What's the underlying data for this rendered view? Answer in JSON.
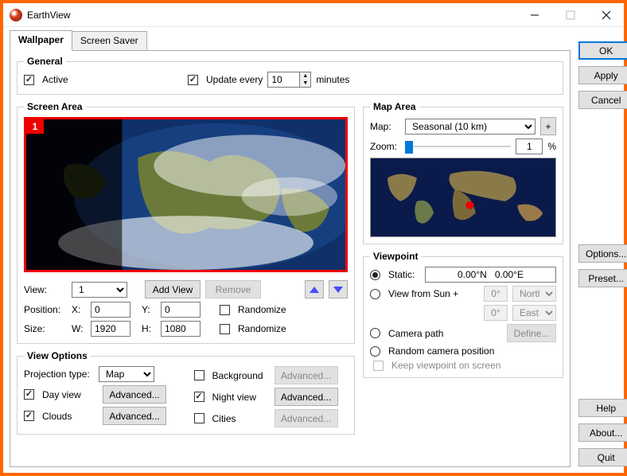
{
  "window": {
    "title": "EarthView"
  },
  "sidebar": {
    "ok": "OK",
    "apply": "Apply",
    "cancel": "Cancel",
    "options": "Options...",
    "preset": "Preset...",
    "help": "Help",
    "about": "About...",
    "quit": "Quit"
  },
  "tabs": {
    "wallpaper": "Wallpaper",
    "screensaver": "Screen Saver"
  },
  "general": {
    "legend": "General",
    "active": "Active",
    "update_every": "Update every",
    "update_value": "10",
    "minutes": "minutes"
  },
  "screen_area": {
    "legend": "Screen Area",
    "badge": "1",
    "view_label": "View:",
    "view_value": "1",
    "add_view": "Add View",
    "remove": "Remove",
    "position": "Position:",
    "x": "X:",
    "x_val": "0",
    "y": "Y:",
    "y_val": "0",
    "size": "Size:",
    "w": "W:",
    "w_val": "1920",
    "h": "H:",
    "h_val": "1080",
    "randomize": "Randomize"
  },
  "view_options": {
    "legend": "View Options",
    "projection": "Projection type:",
    "projection_val": "Map",
    "day": "Day view",
    "clouds": "Clouds",
    "background": "Background",
    "night": "Night view",
    "cities": "Cities",
    "advanced": "Advanced..."
  },
  "map_area": {
    "legend": "Map Area",
    "map_label": "Map:",
    "map_value": "Seasonal (10 km)",
    "plus": "+",
    "zoom_label": "Zoom:",
    "zoom_value": "1",
    "percent": "%"
  },
  "viewpoint": {
    "legend": "Viewpoint",
    "static": "Static:",
    "static_val": "0.00°N   0.00°E",
    "sun": "View from Sun +",
    "sun_deg": "0°",
    "north": "North",
    "east": "East",
    "camera": "Camera path",
    "define": "Define...",
    "random": "Random camera position",
    "keep": "Keep viewpoint on screen"
  }
}
